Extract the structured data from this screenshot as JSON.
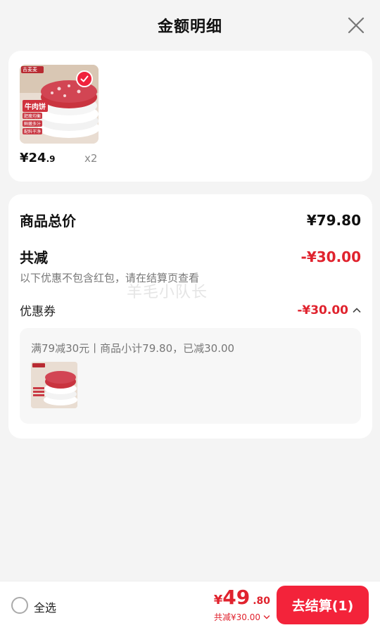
{
  "header": {
    "title": "金额明细"
  },
  "product": {
    "price_main": "¥24",
    "price_decimal": ".9",
    "quantity": "x2",
    "brand_tag": "吉麦麦",
    "image_title": "牛肉饼",
    "image_features": [
      "肥瘦均衡",
      "鲜嫩多汁",
      "配料干净"
    ]
  },
  "detail": {
    "total_label": "商品总价",
    "total_value": "¥79.80",
    "discount_label": "共减",
    "discount_value": "-¥30.00",
    "note": "以下优惠不包含红包，请在结算页查看",
    "coupon_label": "优惠券",
    "coupon_value": "-¥30.00",
    "coupon_desc": "满79减30元丨商品小计79.80，已减30.00",
    "watermark": "羊毛小队长"
  },
  "bottom": {
    "select_all": "全选",
    "currency": "¥",
    "total_int": "49",
    "total_dec": ".80",
    "saved": "共减¥30.00",
    "checkout": "去结算(1)"
  },
  "colors": {
    "accent_red": "#e0232e",
    "button_red": "#f3233a"
  },
  "icons": [
    "close-icon",
    "check-icon",
    "chevron-up-icon",
    "chevron-down-icon",
    "radio-icon"
  ]
}
